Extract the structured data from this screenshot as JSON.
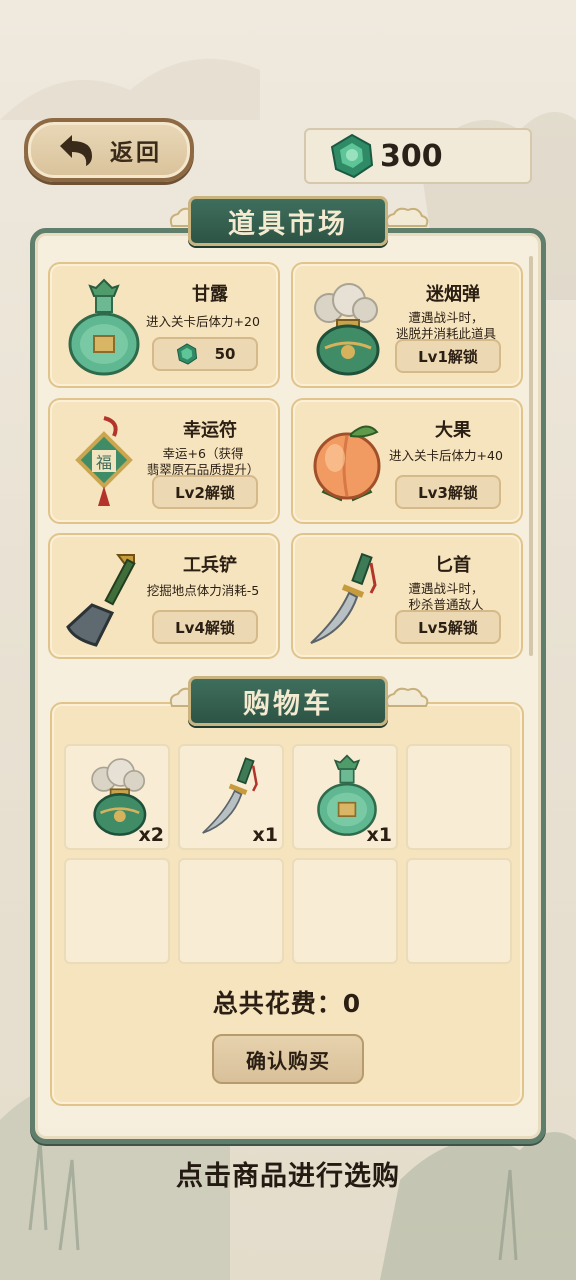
{
  "header": {
    "back_label": "返回",
    "currency_amount": "300"
  },
  "market": {
    "title": "道具市场",
    "items": [
      {
        "name": "甘露",
        "desc_lines": [
          "进入关卡后体力+20"
        ],
        "price": "50",
        "art": "jade-vase-icon"
      },
      {
        "name": "迷烟弹",
        "desc_lines": [
          "遭遇战斗时，",
          "逃脱并消耗此道具"
        ],
        "lock": "Lv1解锁",
        "art": "smoke-jar-icon"
      },
      {
        "name": "幸运符",
        "desc_lines": [
          "幸运+6（获得",
          "翡翠原石品质提升）"
        ],
        "lock": "Lv2解锁",
        "art": "lucky-charm-icon"
      },
      {
        "name": "大果",
        "desc_lines": [
          "进入关卡后体力+40"
        ],
        "lock": "Lv3解锁",
        "art": "peach-icon"
      },
      {
        "name": "工兵铲",
        "desc_lines": [
          "挖掘地点体力消耗-5"
        ],
        "lock": "Lv4解锁",
        "art": "shovel-icon"
      },
      {
        "name": "匕首",
        "desc_lines": [
          "遭遇战斗时，",
          "秒杀普通敌人"
        ],
        "lock": "Lv5解锁",
        "art": "dagger-icon"
      }
    ]
  },
  "cart": {
    "title": "购物车",
    "slots": [
      {
        "art": "smoke-jar-icon",
        "qty": "x2"
      },
      {
        "art": "dagger-icon",
        "qty": "x1"
      },
      {
        "art": "jade-vase-icon",
        "qty": "x1"
      },
      {
        "art": null,
        "qty": ""
      },
      {
        "art": null,
        "qty": ""
      },
      {
        "art": null,
        "qty": ""
      },
      {
        "art": null,
        "qty": ""
      },
      {
        "art": null,
        "qty": ""
      }
    ],
    "total_label": "总共花费：0",
    "confirm_label": "确认购买"
  },
  "footer_hint": "点击商品进行选购",
  "colors": {
    "panel_border": "#5f7e6c",
    "banner": "#2d5444",
    "card_bg": "#f6e4bf",
    "jade": "#3fa37d"
  }
}
